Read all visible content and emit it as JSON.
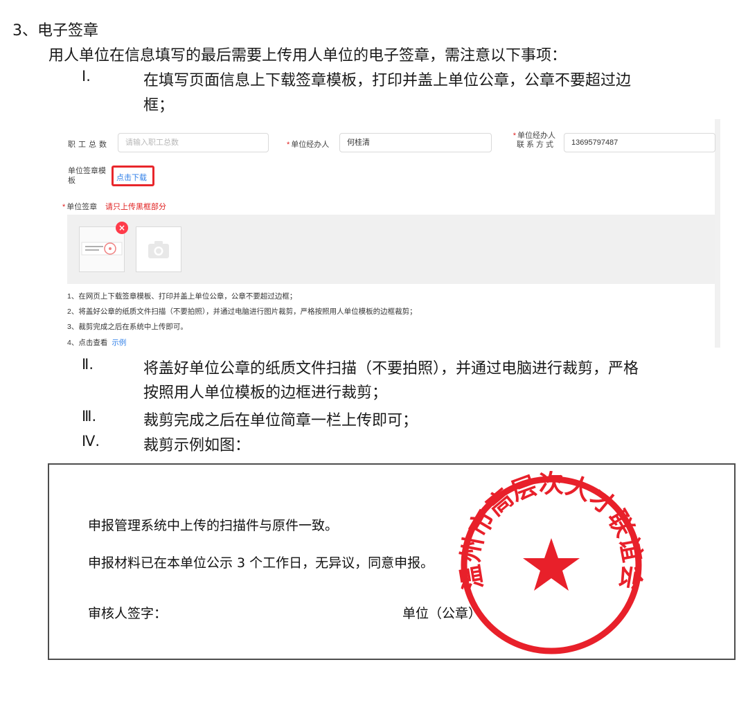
{
  "doc": {
    "section_title": "3、电子签章",
    "intro": "用人单位在信息填写的最后需要上传用人单位的电子签章，需注意以下事项：",
    "items": [
      {
        "num": "Ⅰ.",
        "lines": [
          "在填写页面信息上下载签章模板，打印并盖上单位公章，公章不要超过边",
          "框；"
        ]
      },
      {
        "num": "Ⅱ.",
        "lines": [
          "将盖好单位公章的纸质文件扫描（不要拍照），并通过电脑进行裁剪，严格",
          "按照用人单位模板的边框进行裁剪；"
        ]
      },
      {
        "num": "Ⅲ.",
        "lines": [
          "裁剪完成之后在单位简章一栏上传即可；"
        ]
      },
      {
        "num": "Ⅳ.",
        "lines": [
          "裁剪示例如图："
        ]
      }
    ]
  },
  "form": {
    "staff_total_label": "职工总数",
    "staff_total_placeholder": "请输入职工总数",
    "handler_label": "单位经办人",
    "handler_value": "何桂清",
    "contact_label_line1": "单位经办人",
    "contact_label_line2": "联系方式",
    "contact_value": "13695797487",
    "template_label_line1": "单位签章模",
    "template_label_line2": "板",
    "download_link": "点击下载",
    "seal_label": "单位签章",
    "seal_hint": "请只上传黑框部分",
    "notes": [
      "1、在网页上下载签章模板、打印并盖上单位公章，公章不要超过边框；",
      "2、将盖好公章的纸质文件扫描（不要拍照），并通过电脑进行图片裁剪，严格按照用人单位模板的边框裁剪；",
      "3、裁剪完成之后在系统中上传即可。",
      "4、点击查看"
    ],
    "example_link": "示例"
  },
  "sample": {
    "line1": "申报管理系统中上传的扫描件与原件一致。",
    "line2": "申报材料已在本单位公示 3 个工作日，无异议，同意申报。",
    "reviewer": "审核人签字：",
    "unit": "单位（公章）",
    "seal_text": "温州市高层次人才联谊会"
  },
  "colors": {
    "required": "#e02020",
    "link": "#2f7fe8",
    "highlight": "#e8262b",
    "seal": "#e8202a"
  },
  "icons": [
    "close-icon",
    "camera-icon",
    "star-icon"
  ]
}
